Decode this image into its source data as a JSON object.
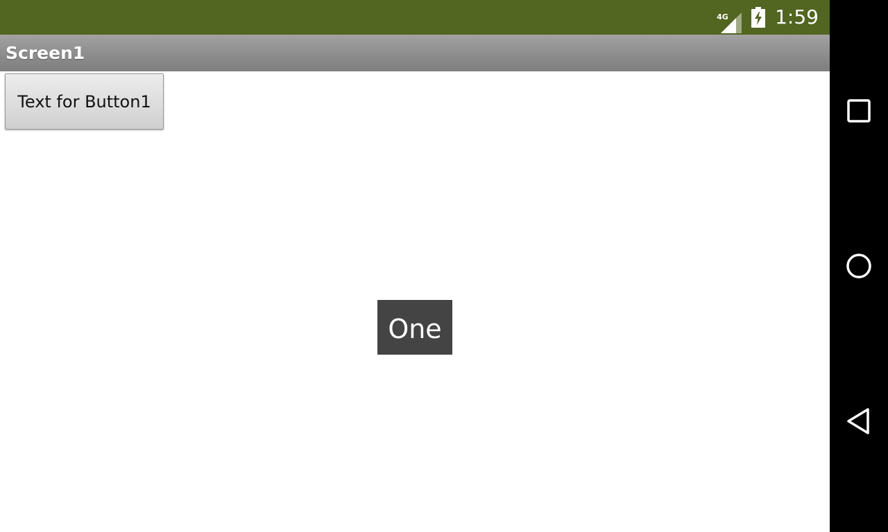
{
  "status_bar": {
    "network_type": "4G",
    "time": "1:59",
    "background_color": "#526521",
    "icons": [
      "signal-icon",
      "battery-charging-icon"
    ]
  },
  "title_bar": {
    "title": "Screen1"
  },
  "main": {
    "button1_label": "Text for Button1"
  },
  "toast": {
    "message": "One"
  },
  "nav_bar": {
    "buttons": [
      "recents-icon",
      "home-icon",
      "back-icon"
    ]
  }
}
